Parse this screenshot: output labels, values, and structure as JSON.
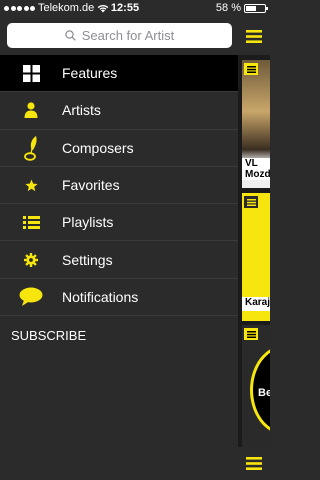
{
  "status": {
    "carrier": "Telekom.de",
    "time": "12:55",
    "battery": "58 %",
    "battery_level": 0.58
  },
  "search": {
    "placeholder": "Search for Artist"
  },
  "menu": {
    "items": [
      {
        "label": "Features",
        "icon": "grid-icon",
        "active": true
      },
      {
        "label": "Artists",
        "icon": "person-icon"
      },
      {
        "label": "Composers",
        "icon": "quill-icon"
      },
      {
        "label": "Favorites",
        "icon": "star-icon"
      },
      {
        "label": "Playlists",
        "icon": "list-icon"
      },
      {
        "label": "Settings",
        "icon": "gear-icon"
      },
      {
        "label": "Notifications",
        "icon": "speech-bubble-icon"
      }
    ],
    "subscribe": "SUBSCRIBE"
  },
  "panel": {
    "cards": [
      {
        "caption_line1": "VL",
        "caption_line2": "Mozd"
      },
      {
        "caption_line1": "Karaj"
      },
      {
        "caption_line1": "Be"
      }
    ]
  },
  "colors": {
    "accent": "#f6e60d",
    "menu_bg": "#2b2b2b",
    "active_bg": "#000000"
  }
}
